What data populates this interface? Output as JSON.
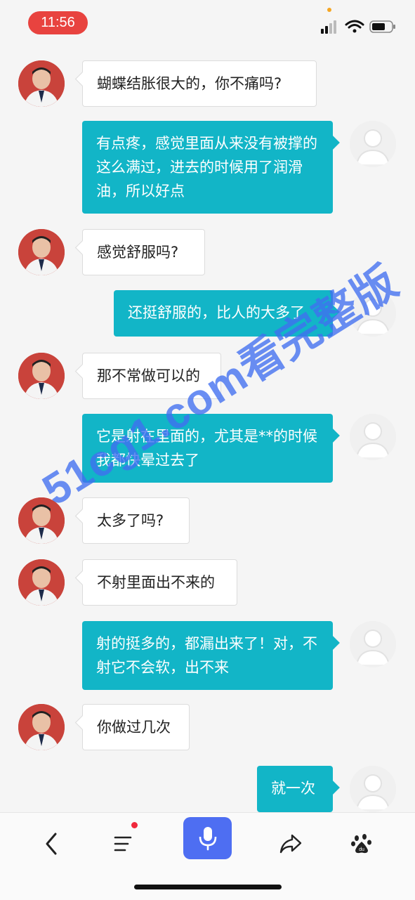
{
  "status_bar": {
    "time": "11:56"
  },
  "watermark": "51cg1.com看完整版",
  "messages": [
    {
      "side": "left",
      "text": "蝴蝶结胀很大的，你不痛吗?"
    },
    {
      "side": "right",
      "text": "有点疼，感觉里面从来没有被撑的这么满过，进去的时候用了润滑油，所以好点"
    },
    {
      "side": "left",
      "text": "感觉舒服吗?"
    },
    {
      "side": "right",
      "text": "还挺舒服的，比人的大多了"
    },
    {
      "side": "left",
      "text": "那不常做可以的"
    },
    {
      "side": "right",
      "text": "它是射在里面的，尤其是**的时候我都快晕过去了"
    },
    {
      "side": "left",
      "text": "太多了吗?"
    },
    {
      "side": "left",
      "text": "不射里面出不来的"
    },
    {
      "side": "right",
      "text": "射的挺多的，都漏出来了！对，不射它不会软，出不来"
    },
    {
      "side": "left",
      "text": "你做过几次"
    },
    {
      "side": "right",
      "text": "就一次"
    }
  ],
  "bottom_bar": {
    "icons": [
      "back-icon",
      "menu-icon",
      "microphone-icon",
      "share-icon",
      "baidu-paw-icon"
    ],
    "accent_color": "#4e6ef2",
    "bubble_color": "#12b5c7"
  }
}
